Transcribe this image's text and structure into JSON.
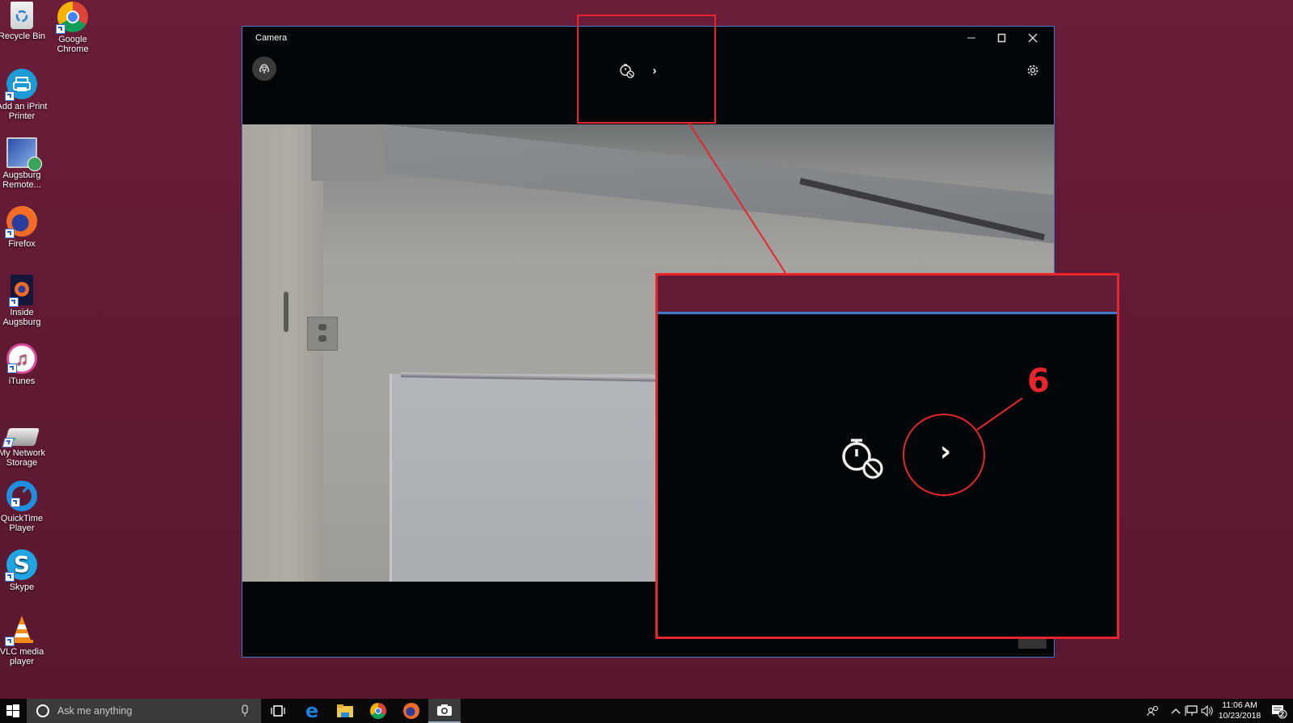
{
  "desktop": {
    "icons": [
      {
        "label": "Recycle Bin",
        "icon": "recycle-bin-icon"
      },
      {
        "label": "Google Chrome",
        "icon": "chrome-icon"
      },
      {
        "label": "Add an iPrint Printer",
        "icon": "printer-icon"
      },
      {
        "label": "Augsburg Remote...",
        "icon": "remote-desktop-icon"
      },
      {
        "label": "Firefox",
        "icon": "firefox-icon"
      },
      {
        "label": "Inside Augsburg",
        "icon": "inside-augsburg-icon"
      },
      {
        "label": "iTunes",
        "icon": "itunes-icon"
      },
      {
        "label": "My Network Storage",
        "icon": "network-storage-icon"
      },
      {
        "label": "QuickTime Player",
        "icon": "quicktime-icon"
      },
      {
        "label": "Skype",
        "icon": "skype-icon"
      },
      {
        "label": "VLC media player",
        "icon": "vlc-icon"
      }
    ]
  },
  "window": {
    "title": "Camera",
    "controls": {
      "minimize": "–",
      "maximize": "☐",
      "close": "✕"
    },
    "toolbar": {
      "left_button": "cloud-upload-icon",
      "timer_icon": "self-timer-off-icon",
      "expand_arrow": "›",
      "settings_icon": "gear-icon"
    }
  },
  "annotation": {
    "step_number": "6",
    "zoom_arrow": "›",
    "accent_color": "#e8242c"
  },
  "taskbar": {
    "search_placeholder": "Ask me anything",
    "pinned": [
      "task-view-icon",
      "edge-icon",
      "file-explorer-icon",
      "chrome-icon",
      "firefox-icon",
      "camera-icon"
    ],
    "clock": {
      "time": "11:06 AM",
      "date": "10/23/2018"
    },
    "notification_count": "2"
  },
  "colors": {
    "desktop_bg": "#5f1a33",
    "window_border": "#3d79c4",
    "annotation_red": "#e8242c"
  }
}
